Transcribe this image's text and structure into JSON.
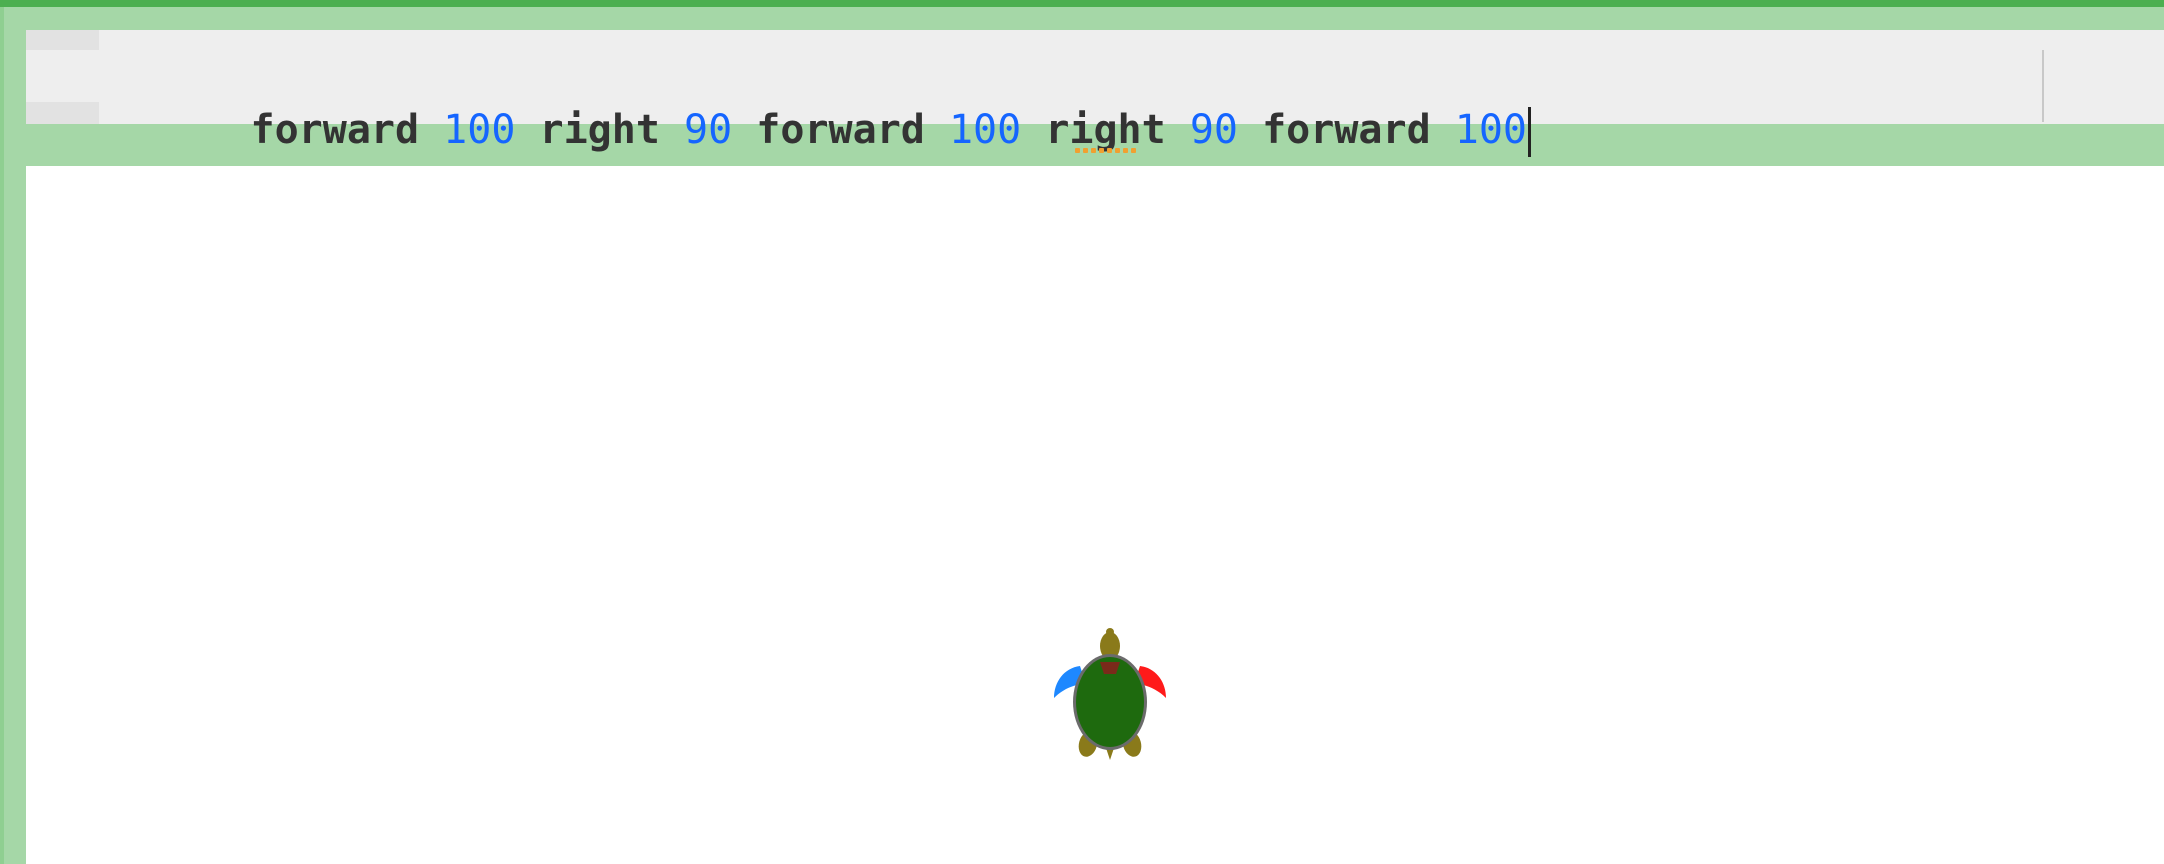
{
  "editor": {
    "tokens": [
      {
        "text": "forward",
        "type": "keyword"
      },
      {
        "text": " ",
        "type": "space"
      },
      {
        "text": "100",
        "type": "number"
      },
      {
        "text": " ",
        "type": "space"
      },
      {
        "text": "right",
        "type": "keyword"
      },
      {
        "text": " ",
        "type": "space"
      },
      {
        "text": "90",
        "type": "number"
      },
      {
        "text": " ",
        "type": "space"
      },
      {
        "text": "forward",
        "type": "keyword"
      },
      {
        "text": " ",
        "type": "space"
      },
      {
        "text": "100",
        "type": "number"
      },
      {
        "text": " ",
        "type": "space"
      },
      {
        "text": "right",
        "type": "keyword"
      },
      {
        "text": " ",
        "type": "space"
      },
      {
        "text": "90",
        "type": "number"
      },
      {
        "text": " ",
        "type": "space"
      },
      {
        "text": "forward",
        "type": "keyword"
      },
      {
        "text": " ",
        "type": "space"
      },
      {
        "text": "100",
        "type": "number"
      }
    ],
    "keyword_color": "#333333",
    "number_color": "#1565ff"
  },
  "canvas": {
    "turtle_icon": "turtle-icon",
    "background": "#ffffff"
  },
  "theme": {
    "frame_color": "#a5d7a7",
    "accent_bar": "#4caf50",
    "handle_color": "#f0a030"
  }
}
